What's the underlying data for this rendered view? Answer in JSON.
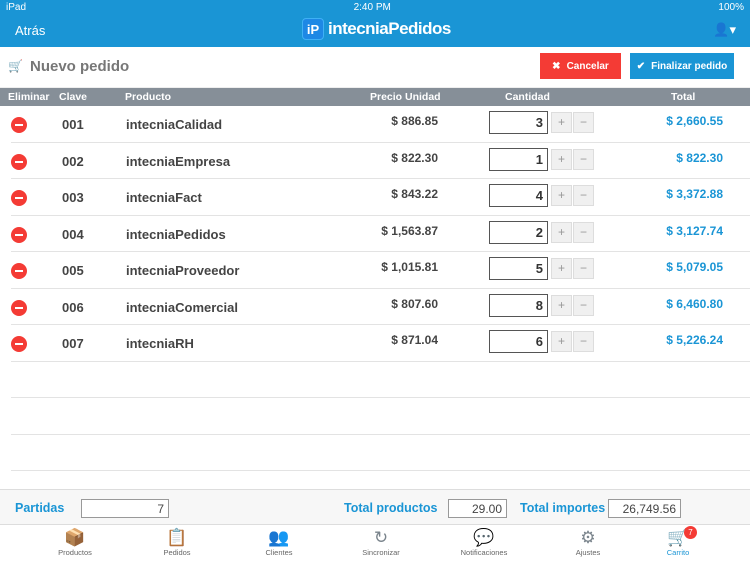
{
  "status": {
    "device": "iPad",
    "time": "2:40 PM",
    "battery": "100%"
  },
  "nav": {
    "back": "Atrás",
    "logo": "iP",
    "app": "intecniaPedidos"
  },
  "header": {
    "title": "Nuevo pedido",
    "cancel": "Cancelar",
    "finish": "Finalizar pedido"
  },
  "columns": {
    "del": "Eliminar",
    "key": "Clave",
    "product": "Producto",
    "price": "Precio Unidad",
    "qty": "Cantidad",
    "total": "Total"
  },
  "rows": [
    {
      "key": "001",
      "product": "intecniaCalidad",
      "price": "$ 886.85",
      "qty": "3",
      "total": "$ 2,660.55"
    },
    {
      "key": "002",
      "product": "intecniaEmpresa",
      "price": "$ 822.30",
      "qty": "1",
      "total": "$ 822.30"
    },
    {
      "key": "003",
      "product": "intecniaFact",
      "price": "$ 843.22",
      "qty": "4",
      "total": "$ 3,372.88"
    },
    {
      "key": "004",
      "product": "intecniaPedidos",
      "price": "$ 1,563.87",
      "qty": "2",
      "total": "$ 3,127.74"
    },
    {
      "key": "005",
      "product": "intecniaProveedor",
      "price": "$ 1,015.81",
      "qty": "5",
      "total": "$ 5,079.05"
    },
    {
      "key": "006",
      "product": "intecniaComercial",
      "price": "$ 807.60",
      "qty": "8",
      "total": "$ 6,460.80"
    },
    {
      "key": "007",
      "product": "intecniaRH",
      "price": "$ 871.04",
      "qty": "6",
      "total": "$ 5,226.24"
    }
  ],
  "footer": {
    "items_label": "Partidas",
    "items": "7",
    "products_label": "Total productos",
    "products": "29.00",
    "amount_label": "Total importes",
    "amount": "26,749.56"
  },
  "tabs": [
    {
      "label": "Productos"
    },
    {
      "label": "Pedidos"
    },
    {
      "label": "Clientes"
    },
    {
      "label": "Sincronizar"
    },
    {
      "label": "Notificaciones"
    },
    {
      "label": "Ajustes"
    },
    {
      "label": "Carrito",
      "badge": "7"
    }
  ],
  "colors": {
    "accent": "#1a95d5",
    "danger": "#f43b35"
  }
}
